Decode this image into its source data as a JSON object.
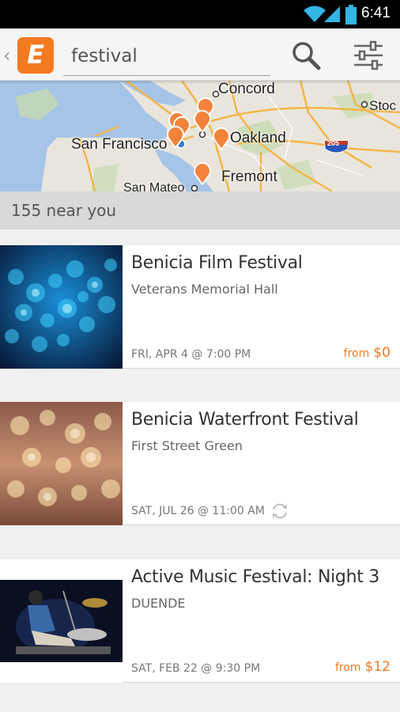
{
  "status_bar": {
    "time": "6:41"
  },
  "header": {
    "search_value": "festival",
    "logo_letter": "E"
  },
  "map": {
    "places": [
      "Concord",
      "San Francisco",
      "Oakland",
      "Fremont",
      "San Mateo",
      "Stoc"
    ],
    "highway_shield": "205"
  },
  "results": {
    "count_label": "155 near you"
  },
  "events": [
    {
      "title": "Benicia Film Festival",
      "venue": "Veterans Memorial Hall",
      "date": "FRI, APR 4 @ 7:00 PM",
      "price_prefix": "from",
      "price": "$0"
    },
    {
      "title": "Benicia Waterfront Festival",
      "venue": "First Street Green",
      "date": "SAT, JUL 26 @ 11:00 AM",
      "repeat_icon": "refresh-icon"
    },
    {
      "title": "Active Music Festival: Night 3",
      "venue": "DUENDE",
      "date": "SAT, FEB 22 @ 9:30 PM",
      "price_prefix": "from",
      "price": "$12"
    }
  ],
  "colors": {
    "accent": "#f47a20",
    "status_bar": "#000000",
    "wifi": "#33b5e5"
  }
}
